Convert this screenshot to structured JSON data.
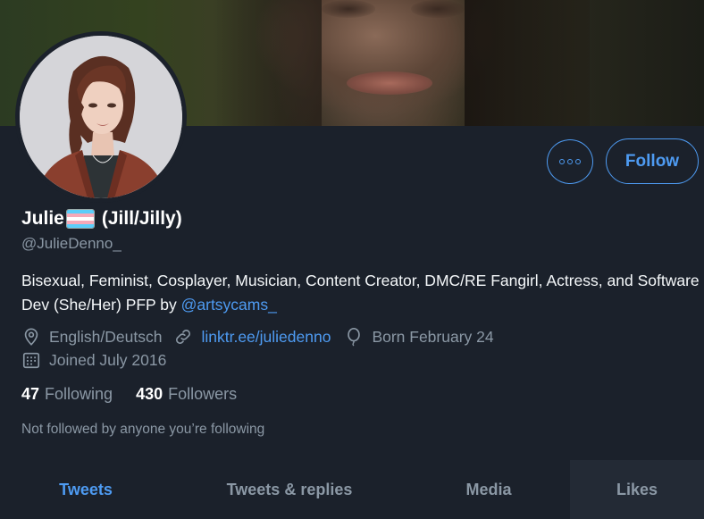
{
  "profile": {
    "display_name": "Julie",
    "pronouns_suffix": "(Jill/Jilly)",
    "handle": "@JulieDenno_",
    "bio_text": "Bisexual, Feminist, Cosplayer, Musician, Content Creator, DMC/RE Fangirl, Actress, and Software Dev (She/Her) PFP by ",
    "bio_mention": "@artsycams_",
    "location": "English/Deutsch",
    "website": "linktr.ee/juliedenno",
    "birthday": "Born February 24",
    "joined": "Joined July 2016",
    "following_count": "47",
    "following_label": "Following",
    "followers_count": "430",
    "followers_label": "Followers",
    "followed_by_note": "Not followed by anyone you’re following"
  },
  "actions": {
    "more_icon": "more-options-icon",
    "follow_label": "Follow"
  },
  "tabs": [
    {
      "label": "Tweets",
      "active": true
    },
    {
      "label": "Tweets & replies",
      "active": false
    },
    {
      "label": "Media",
      "active": false
    },
    {
      "label": "Likes",
      "active": false
    }
  ],
  "icons": {
    "location": "location-pin-icon",
    "link": "link-icon",
    "birthday": "balloon-icon",
    "joined": "calendar-icon",
    "flag": "transgender-flag-emoji"
  },
  "colors": {
    "background": "#1b212b",
    "accent": "#4e9bf2",
    "muted_text": "#8b98a5",
    "flag_blue": "#5bcefa",
    "flag_pink": "#f5a9b8",
    "flag_white": "#ffffff"
  }
}
